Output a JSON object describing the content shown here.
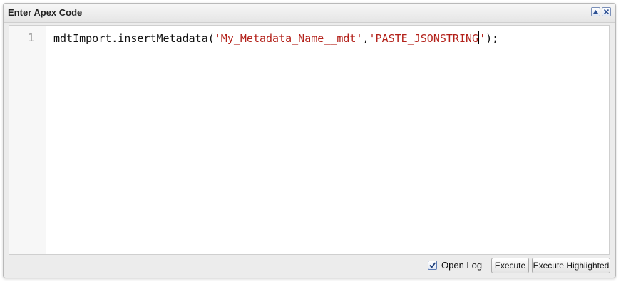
{
  "dialog": {
    "title": "Enter Apex Code",
    "collapse_icon": "chevron-up-icon",
    "close_icon": "close-icon"
  },
  "editor": {
    "line_number": "1",
    "code": {
      "prefix": "mdtImport.insertMetadata(",
      "arg1": "'My_Metadata_Name__mdt'",
      "comma": ",",
      "arg2_before_cursor": "'PASTE_JSONSTRING",
      "arg2_after_cursor": "'",
      "suffix": ");"
    }
  },
  "footer": {
    "open_log_label": "Open Log",
    "open_log_checked": true,
    "execute_label": "Execute",
    "execute_highlighted_label": "Execute Highlighted"
  },
  "colors": {
    "string": "#b3211a",
    "code_text": "#111111",
    "line_number": "#9a9a9a"
  }
}
